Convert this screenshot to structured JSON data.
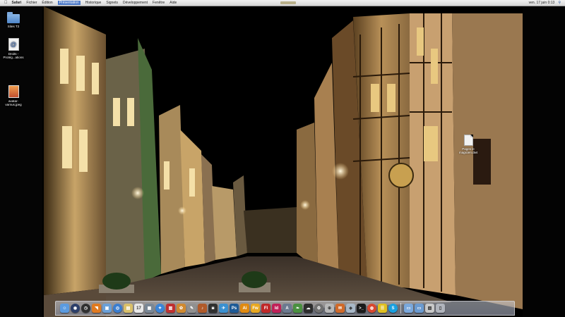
{
  "menubar": {
    "apple_label": "",
    "items": [
      {
        "label": "Safari",
        "app": true
      },
      {
        "label": "Fichier"
      },
      {
        "label": "Édition"
      },
      {
        "label": "Présentation",
        "active": true
      },
      {
        "label": "Historique"
      },
      {
        "label": "Signets"
      },
      {
        "label": "Développement"
      },
      {
        "label": "Fenêtre"
      },
      {
        "label": "Aide"
      }
    ],
    "clock": "ven. 17 juin 0:13",
    "spotlight_icon": "search-icon"
  },
  "desktop": {
    "icons": [
      {
        "name": "folder-icon",
        "label": "Sites T2"
      },
      {
        "name": "document-icon",
        "label": "Droits - Protég...ations"
      },
      {
        "name": "image-file-icon",
        "label": "avatar-\nvarnus.jpeg"
      },
      {
        "name": "page-icon",
        "label": "Pages le magicien.dwt"
      }
    ]
  },
  "dock": {
    "apps": [
      {
        "name": "finder-icon",
        "glyph": "☺",
        "color": "#5b9be0"
      },
      {
        "name": "dashboard-icon",
        "glyph": "◉",
        "color": "#2c3f6a",
        "round": true
      },
      {
        "name": "clock-icon",
        "glyph": "◷",
        "color": "#303030",
        "round": true
      },
      {
        "name": "rss-icon",
        "glyph": "◥",
        "color": "#e07a20"
      },
      {
        "name": "photo-app-icon",
        "glyph": "▣",
        "color": "#6aa0d8"
      },
      {
        "name": "globe-icon",
        "glyph": "◎",
        "color": "#3a7ed0",
        "round": true
      },
      {
        "name": "notes-icon",
        "glyph": "▤",
        "color": "#d9c06a"
      },
      {
        "name": "calendar-icon",
        "glyph": "17",
        "color": "#e8e8e8"
      },
      {
        "name": "preview-icon",
        "glyph": "▦",
        "color": "#7a8896"
      },
      {
        "name": "safari-icon",
        "glyph": "✦",
        "color": "#3b85d8",
        "round": true
      },
      {
        "name": "reader-icon",
        "glyph": "▥",
        "color": "#c03030"
      },
      {
        "name": "iphoto-icon",
        "glyph": "✿",
        "color": "#d08a30"
      },
      {
        "name": "tools-icon",
        "glyph": "✎",
        "color": "#909090"
      },
      {
        "name": "guitar-icon",
        "glyph": "♪",
        "color": "#b05a2a"
      },
      {
        "name": "camera-icon",
        "glyph": "◙",
        "color": "#303030"
      },
      {
        "name": "bird-icon",
        "glyph": "✈",
        "color": "#3a90d0"
      },
      {
        "name": "photoshop-icon",
        "glyph": "Ps",
        "color": "#1e5a96"
      },
      {
        "name": "illustrator-icon",
        "glyph": "Ai",
        "color": "#e08a10"
      },
      {
        "name": "fireworks-icon",
        "glyph": "Fw",
        "color": "#e8a820"
      },
      {
        "name": "flash-icon",
        "glyph": "Fl",
        "color": "#c02828"
      },
      {
        "name": "indesign-icon",
        "glyph": "Id",
        "color": "#c02058"
      },
      {
        "name": "font-icon",
        "glyph": "A",
        "color": "#6c7a90"
      },
      {
        "name": "leaf-icon",
        "glyph": "❧",
        "color": "#4a9040"
      },
      {
        "name": "cloud-icon",
        "glyph": "☁",
        "color": "#2c2c2c"
      },
      {
        "name": "gear-icon",
        "glyph": "⚙",
        "color": "#707070",
        "round": true
      },
      {
        "name": "network-icon",
        "glyph": "⊕",
        "color": "#b8b8b8"
      },
      {
        "name": "mail-icon",
        "glyph": "✉",
        "color": "#d06a2a"
      },
      {
        "name": "box-icon",
        "glyph": "◈",
        "color": "#a8b8c8"
      },
      {
        "name": "terminal-icon",
        "glyph": ">_",
        "color": "#1a1a1a"
      },
      {
        "name": "chrome-icon",
        "glyph": "◍",
        "color": "#d84830",
        "round": true
      },
      {
        "name": "chat-icon",
        "glyph": "☰",
        "color": "#e0c020"
      },
      {
        "name": "skype-icon",
        "glyph": "S",
        "color": "#18a0e0",
        "round": true
      }
    ],
    "right": [
      {
        "name": "downloads-folder-icon",
        "glyph": "▭",
        "color": "#7aa8dc"
      },
      {
        "name": "documents-folder-icon",
        "glyph": "▭",
        "color": "#6a9ad0"
      },
      {
        "name": "stack-icon",
        "glyph": "▧",
        "color": "#c8c8c8"
      },
      {
        "name": "trash-icon",
        "glyph": "▯",
        "color": "#b0b4bc"
      }
    ]
  }
}
